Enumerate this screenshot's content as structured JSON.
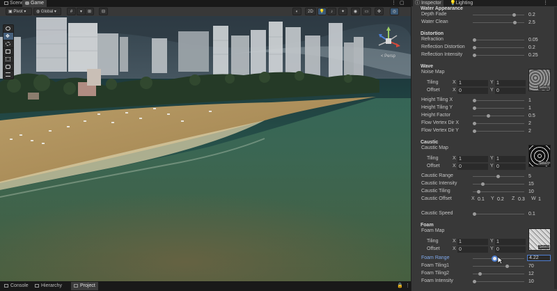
{
  "top_tabs": {
    "scene": "Scene",
    "game": "Game"
  },
  "toolbar": {
    "pivot": "Pivot",
    "global": "Global",
    "mode_2d": "2D"
  },
  "gizmo": {
    "persp_label": "< Persp"
  },
  "bottom_tabs": {
    "console": "Console",
    "hierarchy": "Hierarchy",
    "project": "Project"
  },
  "inspector": {
    "tabs": {
      "inspector": "Inspector",
      "lighting": "Lighting"
    },
    "water_appearance": {
      "title": "Water Appearance",
      "depth_fade": {
        "label": "Depth Fade",
        "value": "0.2"
      },
      "water_clean": {
        "label": "Water Clean",
        "value": "2.5"
      }
    },
    "distortion": {
      "title": "Distortion",
      "refraction": {
        "label": "Refraction",
        "value": "0.05"
      },
      "reflection_distortion": {
        "label": "Reflection Distortion",
        "value": "0.2"
      },
      "reflection_intensity": {
        "label": "Reflection Intensity",
        "value": "0.25"
      }
    },
    "wave": {
      "title": "Wave",
      "noise_map": "Noise Map",
      "tiling": {
        "label": "Tiling",
        "x": "1",
        "y": "1"
      },
      "offset": {
        "label": "Offset",
        "x": "0",
        "y": "0"
      },
      "height_tiling_x": {
        "label": "Height Tiling X",
        "value": "1"
      },
      "height_tiling_y": {
        "label": "Height Tiling Y",
        "value": "1"
      },
      "height_factor": {
        "label": "Height Factor",
        "value": "0.5"
      },
      "flow_vertex_dir_x": {
        "label": "Flow Vertex Dir X",
        "value": "2"
      },
      "flow_vertex_dir_y": {
        "label": "Flow Vertex Dir Y",
        "value": "2"
      },
      "select": "Select"
    },
    "caustic": {
      "title": "Caustic",
      "caustic_map": "Caustic Map",
      "tiling": {
        "label": "Tiling",
        "x": "1",
        "y": "1"
      },
      "offset": {
        "label": "Offset",
        "x": "0",
        "y": "0"
      },
      "caustic_range": {
        "label": "Caustic Range",
        "value": "5"
      },
      "caustic_intensity": {
        "label": "Caustic Intensity",
        "value": "15"
      },
      "caustic_tiling": {
        "label": "Caustic Tiling",
        "value": "10"
      },
      "caustic_offset": {
        "label": "Caustic Offset",
        "x": "0.1",
        "y": "0.2",
        "z": "0.3",
        "w": "1"
      },
      "caustic_speed": {
        "label": "Caustic Speed",
        "value": "0.1"
      },
      "select": "Select"
    },
    "foam": {
      "title": "Foam",
      "foam_map": "Foam Map",
      "tiling": {
        "label": "Tiling",
        "x": "1",
        "y": "1"
      },
      "offset": {
        "label": "Offset",
        "x": "0",
        "y": "0"
      },
      "foam_range": {
        "label": "Foam Range",
        "value": "4.22"
      },
      "foam_tiling1": {
        "label": "Foam Tiling1",
        "value": "70"
      },
      "foam_tiling2": {
        "label": "Foam Tiling2",
        "value": "12"
      },
      "foam_intensity": {
        "label": "Foam Intensity",
        "value": "10"
      },
      "select": "Select"
    },
    "axis": {
      "x": "X",
      "y": "Y",
      "z": "Z",
      "w": "W"
    }
  },
  "colors": {
    "accent": "#4f7fd1",
    "panel": "#383838",
    "dark": "#191919"
  }
}
